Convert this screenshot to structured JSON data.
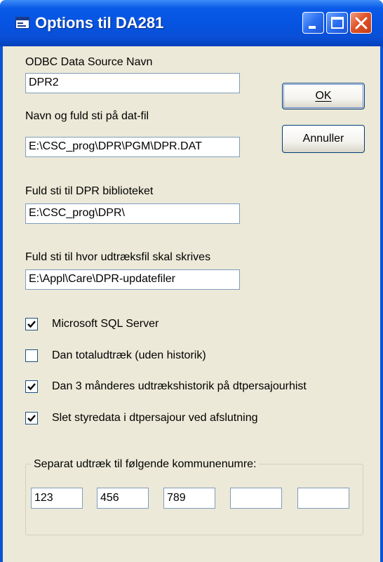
{
  "window": {
    "title": "Options til DA281",
    "controls": [
      "minimize-icon",
      "maximize-icon",
      "close-icon"
    ]
  },
  "odbc": {
    "label": "ODBC Data Source Navn",
    "value": "DPR2"
  },
  "datfile": {
    "label": "Navn og fuld sti på dat-fil",
    "value": "E:\\CSC_prog\\DPR\\PGM\\DPR.DAT"
  },
  "library": {
    "label": "Fuld sti til DPR biblioteket",
    "value": "E:\\CSC_prog\\DPR\\"
  },
  "extract": {
    "label": "Fuld sti til hvor udtræksfil skal skrives",
    "value": "E:\\Appl\\Care\\DPR-updatefiler"
  },
  "buttons": {
    "ok": "OK",
    "cancel": "Annuller"
  },
  "checkboxes": [
    {
      "label": "Microsoft SQL Server",
      "checked": true
    },
    {
      "label": "Dan totaludtræk (uden historik)",
      "checked": false
    },
    {
      "label": "Dan 3 månderes udtrækshistorik på dtpersajourhist",
      "checked": true
    },
    {
      "label": "Slet styredata i dtpersajour ved afslutning",
      "checked": true
    }
  ],
  "kommune": {
    "legend": "Separat udtræk til  følgende kommunenumre:",
    "values": [
      "123",
      "456",
      "789",
      "",
      ""
    ]
  }
}
